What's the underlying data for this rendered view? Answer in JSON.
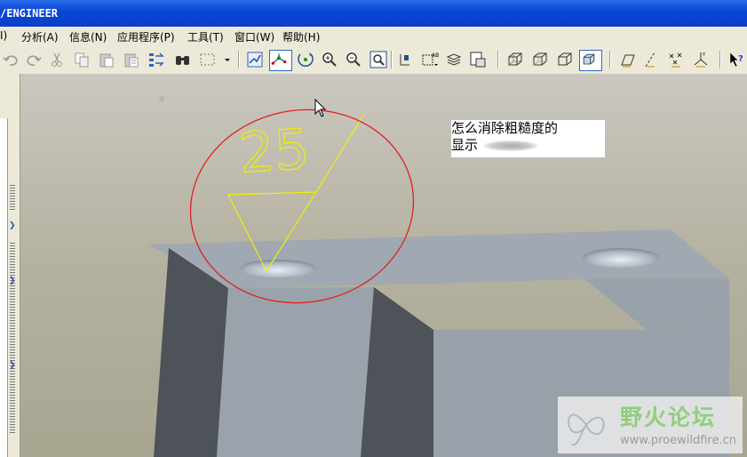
{
  "window": {
    "title": "/ENGINEER"
  },
  "menu": {
    "items": [
      {
        "name": "menu-partial",
        "label": "I)"
      },
      {
        "name": "menu-analysis",
        "label": "分析(A)"
      },
      {
        "name": "menu-info",
        "label": "信息(N)"
      },
      {
        "name": "menu-applications",
        "label": "应用程序(P)"
      },
      {
        "name": "menu-tools",
        "label": "工具(T)"
      },
      {
        "name": "menu-window",
        "label": "窗口(W)"
      },
      {
        "name": "menu-help",
        "label": "帮助(H)"
      }
    ]
  },
  "toolbar": {
    "icons": [
      "undo-icon",
      "redo-icon",
      "cut-icon",
      "copy-icon",
      "paste-icon",
      "paste-special-icon",
      "regenerate-icon",
      "find-icon",
      "select-box-icon",
      "dropdown-icon",
      "datum-display-icon",
      "spin-center-icon",
      "orient-icon",
      "zoom-in-icon",
      "zoom-out-icon",
      "refit-icon",
      "datum-point-icon",
      "annotation-icon",
      "layers-icon",
      "view-manager-icon",
      "wireframe-icon",
      "hidden-line-icon",
      "no-hidden-icon",
      "shading-icon",
      "datum-planes-icon",
      "datum-axes-icon",
      "datum-points-icon",
      "coordinate-systems-icon",
      "whats-this-icon"
    ]
  },
  "viewport": {
    "annotation_value": "25",
    "note_line1": "怎么消除粗糙度的",
    "note_line2": "显示"
  },
  "watermark": {
    "title": "野火论坛",
    "url": "www.proewildfire.cn"
  },
  "colors": {
    "title_bar": "#0a46d8",
    "annotation_yellow": "#f0f000",
    "highlight_circle": "#e02020",
    "model_gray": "#9aa3ab"
  }
}
